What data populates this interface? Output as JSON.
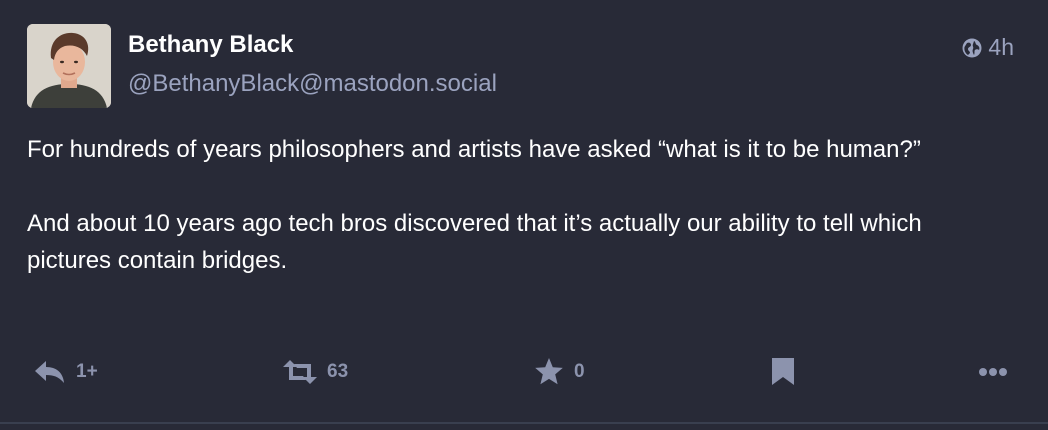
{
  "status": {
    "author": {
      "display_name": "Bethany Black",
      "handle": "@BethanyBlack@mastodon.social"
    },
    "visibility_icon": "globe-icon",
    "relative_time": "4h",
    "paragraphs": [
      "For hundreds of years philosophers and artists have asked “what is it to be human?”",
      "And about 10 years ago tech bros discovered that it’s actually our ability to tell which pictures contain bridges."
    ],
    "actions": {
      "reply_count": "1+",
      "boost_count": "63",
      "favourite_count": "0"
    }
  },
  "colors": {
    "background": "#282a37",
    "text": "#ffffff",
    "secondary_text": "#9ba3bf",
    "action_icon": "#8c93ad"
  }
}
